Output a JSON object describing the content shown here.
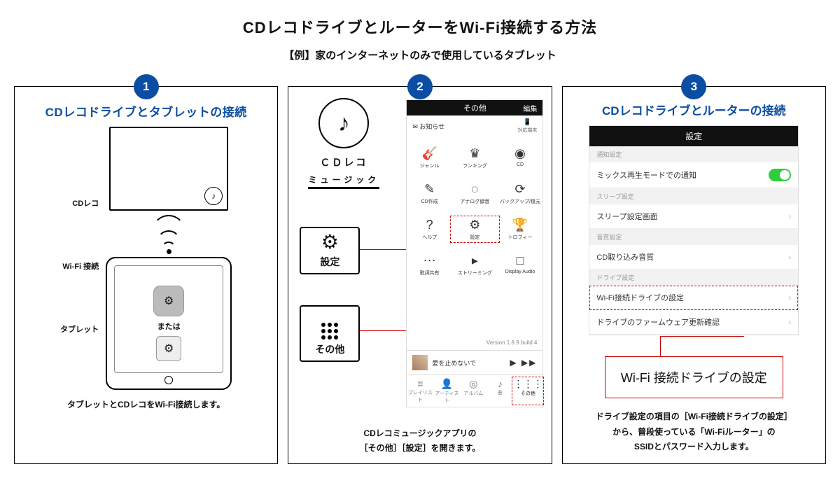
{
  "title": "CDレコドライブとルーターをWi-Fi接続する方法",
  "subtitle": "【例】家のインターネットのみで使用しているタブレット",
  "step1": {
    "badge": "1",
    "heading": "CDレコドライブとタブレットの接続",
    "label_cdreco": "CDレコ",
    "label_wifi": "Wi-Fi 接続",
    "label_tablet": "タブレット",
    "or": "または",
    "caption": "タブレットとCDレコをWi-Fi接続します。"
  },
  "step2": {
    "badge": "2",
    "logo_line1": "ＣＤレコ",
    "logo_line2": "ミュージック",
    "callout_settings": "設定",
    "callout_other": "その他",
    "phone": {
      "title": "その他",
      "edit": "編集",
      "notice_icon": "✉",
      "notice": "お知らせ",
      "right_icon_label": "対応端末",
      "grid": [
        {
          "icon": "🎸",
          "label": "ジャンル"
        },
        {
          "icon": "♛",
          "label": "ランキング"
        },
        {
          "icon": "◉",
          "label": "CD"
        },
        {
          "icon": "✎",
          "label": "CD作成"
        },
        {
          "icon": "◌",
          "label": "アナログ録音"
        },
        {
          "icon": "⟳",
          "label": "バックアップ/復元"
        },
        {
          "icon": "?",
          "label": "ヘルプ"
        },
        {
          "icon": "⚙",
          "label": "設定",
          "hl": true
        },
        {
          "icon": "🏆",
          "label": "トロフィー"
        },
        {
          "icon": "⋯",
          "label": "歌詞共有"
        },
        {
          "icon": "▸",
          "label": "ストリーミング"
        },
        {
          "icon": "□",
          "label": "Display Audio"
        }
      ],
      "version": "Version 1.8.9 build 4",
      "now_playing": "愛を止めないで",
      "tabs": [
        {
          "icon": "≡",
          "label": "プレイリスト"
        },
        {
          "icon": "👤",
          "label": "アーティスト"
        },
        {
          "icon": "◎",
          "label": "アルバム"
        },
        {
          "icon": "♪",
          "label": "曲"
        },
        {
          "icon": "⋮⋮⋮",
          "label": "その他",
          "hl": true
        }
      ]
    },
    "caption_l1": "CDレコミュージックアプリの",
    "caption_l2": "［その他］［設定］を開きます。"
  },
  "step3": {
    "badge": "3",
    "heading": "CDレコドライブとルーターの接続",
    "settings": {
      "title": "設定",
      "sec1": "通知設定",
      "row1": "ミックス再生モードでの通知",
      "sec2": "スリープ設定",
      "row2": "スリープ設定画面",
      "sec3": "音質設定",
      "row3": "CD取り込み音質",
      "sec4": "ドライブ設定",
      "row4": "Wi-Fi接続ドライブの設定",
      "row5": "ドライブのファームウェア更新確認"
    },
    "red_callout": "Wi-Fi 接続ドライブの設定",
    "caption_l1": "ドライブ設定の項目の［Wi-Fi接続ドライブの設定］",
    "caption_l2": "から、普段使っている「Wi-Fiルーター」の",
    "caption_l3": "SSIDとパスワード入力します。"
  }
}
